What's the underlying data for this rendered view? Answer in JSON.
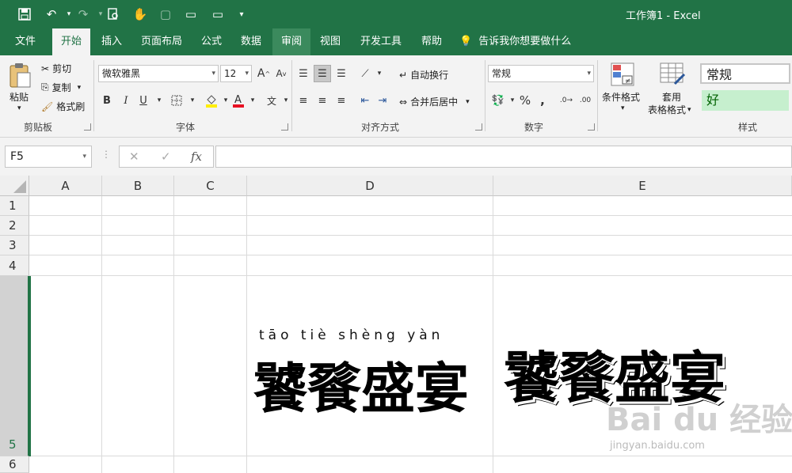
{
  "window": {
    "title": "工作簿1  -  Excel"
  },
  "tabs": [
    {
      "label": "文件"
    },
    {
      "label": "开始"
    },
    {
      "label": "插入"
    },
    {
      "label": "页面布局"
    },
    {
      "label": "公式"
    },
    {
      "label": "数据"
    },
    {
      "label": "审阅"
    },
    {
      "label": "视图"
    },
    {
      "label": "开发工具"
    },
    {
      "label": "帮助"
    }
  ],
  "tellme": "告诉我你想要做什么",
  "clipboard": {
    "paste": "粘贴",
    "cut": "剪切",
    "copy": "复制",
    "format_painter": "格式刷",
    "group": "剪贴板"
  },
  "font": {
    "name": "微软雅黑",
    "size": "12",
    "group": "字体",
    "bold": "B",
    "italic": "I",
    "underline": "U",
    "grow": "A",
    "shrink": "A",
    "phonetic": "文"
  },
  "alignment": {
    "wrap": "自动换行",
    "merge": "合并后居中",
    "group": "对齐方式"
  },
  "number": {
    "format": "常规",
    "percent": "%",
    "comma": ",",
    "group": "数字"
  },
  "styles": {
    "conditional": "条件格式",
    "table_1": "套用",
    "table_2": "表格格式",
    "normal": "常规",
    "good": "好",
    "group": "样式"
  },
  "formula_bar": {
    "name_box": "F5",
    "fx": "fx",
    "cancel": "✕",
    "enter": "✓",
    "content": ""
  },
  "columns": [
    "A",
    "B",
    "C",
    "D",
    "E"
  ],
  "rows": [
    "1",
    "2",
    "3",
    "4",
    "5",
    "6"
  ],
  "cells": {
    "D5_pinyin": "tāo tiè shèng yàn",
    "D5_text": "饕餮盛宴",
    "E5_text": "饕餮盛宴"
  },
  "watermark": {
    "logo": "Bai du 经验",
    "url": "jingyan.baidu.com"
  }
}
